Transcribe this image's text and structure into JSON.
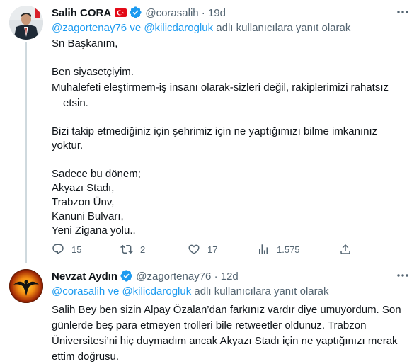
{
  "tweets": [
    {
      "name": "Salih CORA",
      "handle": "@corasalih",
      "date": "19d",
      "reply_to": [
        "@zagortenay76",
        "@kilicdarogluk"
      ],
      "reply_joiner": "ve",
      "reply_suffix": "adlı kullanıcılara yanıt olarak",
      "lines": [
        "Sn Başkanım,",
        "",
        "Ben siyasetçiyim.",
        "Muhalefeti eleştirmem-iş insanı olarak-sizleri değil, rakiplerimizi rahatsız",
        "etsin.",
        "",
        "Bizi takip etmediğiniz için şehrimiz için ne yaptığımızı bilme imkanınız",
        "yoktur.",
        "",
        "Sadece bu dönem;",
        "Akyazı Stadı,",
        "Trabzon Ünv,",
        "Kanuni Bulvarı,",
        "Yeni Zigana yolu.."
      ],
      "stats": {
        "replies": "15",
        "retweets": "2",
        "likes": "17",
        "views": "1.575"
      }
    },
    {
      "name": "Nevzat Aydın",
      "handle": "@zagortenay76",
      "date": "12d",
      "reply_to": [
        "@corasalih",
        "@kilicdarogluk"
      ],
      "reply_joiner": "ve",
      "reply_suffix": "adlı kullanıcılara yanıt olarak",
      "lines": [
        "Salih Bey ben sizin Alpay Özalan’dan farkınız vardır diye umuyordum. Son",
        "günlerde beş para etmeyen trolleri bile retweetler oldunuz. Trabzon",
        "Üniversitesi’ni hiç duymadım ancak Akyazı Stadı için ne yaptığınızı merak",
        "ettim doğrusu."
      ]
    }
  ],
  "colors": {
    "accent": "#1d9bf0",
    "muted": "#536471",
    "text": "#0f1419"
  },
  "icons": [
    "more-icon",
    "verified-icon",
    "turkey-flag-icon",
    "reply-icon",
    "retweet-icon",
    "like-icon",
    "views-icon",
    "share-icon"
  ]
}
